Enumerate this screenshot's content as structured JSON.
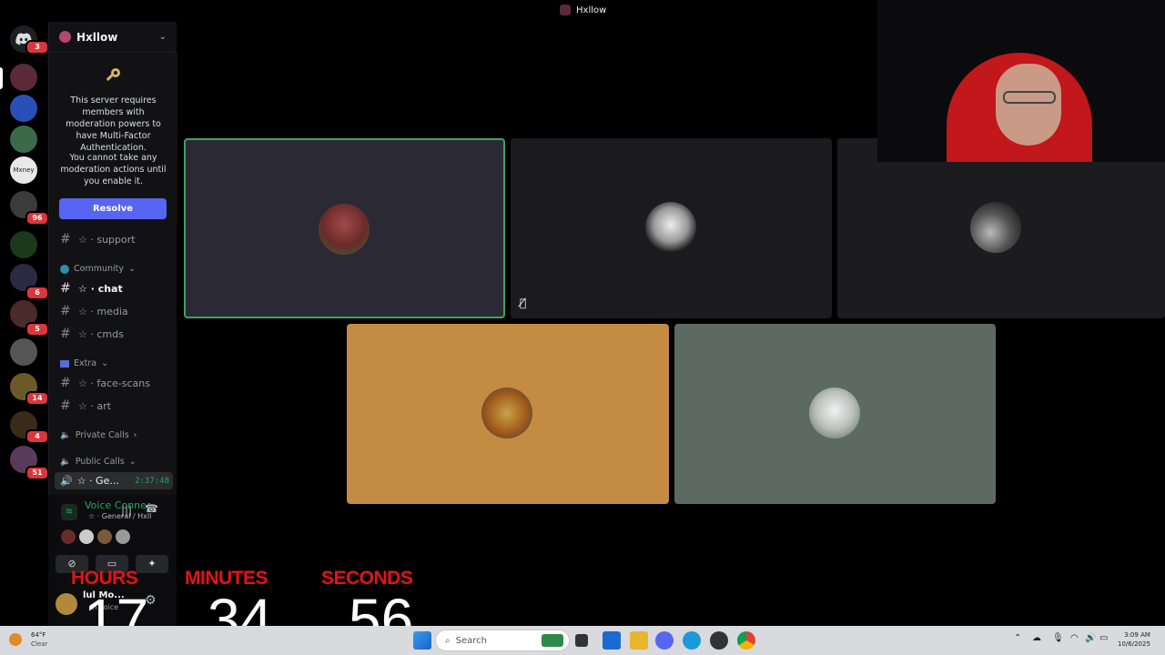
{
  "window": {
    "title": "Hxllow"
  },
  "rail": {
    "home_badge": "3",
    "badges": [
      {
        "label": "96"
      },
      {
        "label": "6"
      },
      {
        "label": "5"
      },
      {
        "label": "14"
      },
      {
        "label": "4"
      },
      {
        "label": "51"
      }
    ]
  },
  "server": {
    "name": "Hxllow",
    "mfa_notice": "This server requires members with moderation powers to have Multi-Factor Authentication.",
    "mfa_notice2": "You cannot take any moderation actions until you enable it.",
    "resolve_label": "Resolve"
  },
  "channels": {
    "support": "☆ · support",
    "community_cat": "Community",
    "chat": "☆ · chat",
    "media": "☆ · media",
    "cmds": "☆ · cmds",
    "extra_cat": "Extra",
    "face_scans": "☆ · face-scans",
    "art": "☆ · art",
    "private_calls": "Private Calls",
    "public_calls": "Public Calls",
    "general": "☆ · Ge...",
    "general_timer": "2:37:48"
  },
  "voice": {
    "status": "Voice Connecte",
    "location": "☆ · General / Hxll..."
  },
  "user": {
    "name": "lul Mo...",
    "status": "In voice"
  },
  "timer": {
    "hours_label": "HOURS",
    "minutes_label": "MINUTES",
    "seconds_label": "SECONDS",
    "hours": "17",
    "minutes": "34",
    "seconds": "56"
  },
  "taskbar": {
    "weather_temp": "64°F",
    "weather_desc": "Clear",
    "search_placeholder": "Search",
    "time": "3:09 AM",
    "date": "10/6/2025"
  },
  "colors": {
    "accent": "#5865f2",
    "speaking": "#23a55a",
    "timer_red": "#e4121a",
    "tile_orange": "#c48b43",
    "tile_sage": "#5d6a63"
  }
}
